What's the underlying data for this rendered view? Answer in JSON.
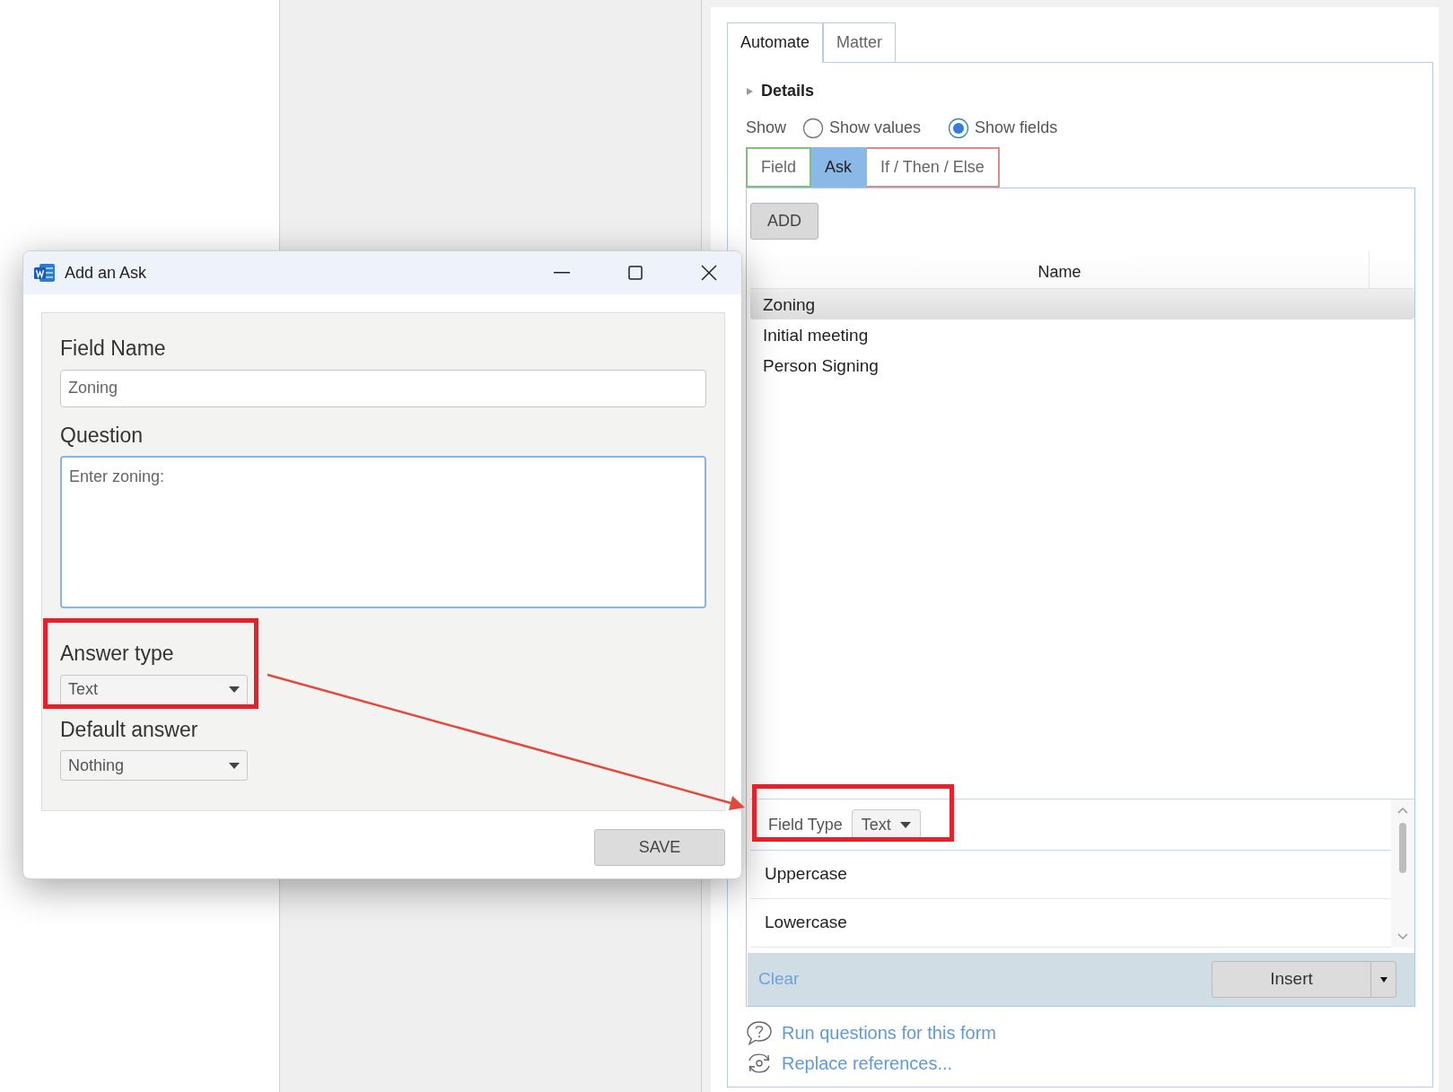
{
  "dialog": {
    "title": "Add an Ask",
    "field_name": {
      "label": "Field Name",
      "value": "Zoning"
    },
    "question": {
      "label": "Question",
      "value": "Enter zoning:"
    },
    "answer_type": {
      "label": "Answer type",
      "value": "Text"
    },
    "default_answer": {
      "label": "Default answer",
      "value": "Nothing"
    },
    "save_button": "SAVE"
  },
  "panel": {
    "tabs": [
      {
        "label": "Automate",
        "selected": true
      },
      {
        "label": "Matter",
        "selected": false
      }
    ],
    "details": {
      "label": "Details",
      "expanded": false
    },
    "show": {
      "label": "Show",
      "options": [
        {
          "label": "Show values",
          "selected": false
        },
        {
          "label": "Show fields",
          "selected": true
        }
      ]
    },
    "subtabs": [
      {
        "label": "Field",
        "selected": false,
        "color": "#7cc576"
      },
      {
        "label": "Ask",
        "selected": true,
        "color": "#8ab9e8"
      },
      {
        "label": "If / Then / Else",
        "selected": false,
        "color": "#e08a8a"
      }
    ],
    "add_button": "ADD",
    "table": {
      "columns": [
        "Name"
      ],
      "rows": [
        {
          "name": "Zoning",
          "selected": true
        },
        {
          "name": "Initial meeting",
          "selected": false
        },
        {
          "name": "Person Signing",
          "selected": false
        }
      ]
    },
    "field_type": {
      "label": "Field Type",
      "value": "Text"
    },
    "options": [
      "Uppercase",
      "Lowercase"
    ],
    "clear": "Clear",
    "insert": "Insert",
    "links": [
      {
        "kind": "question",
        "text": "Run questions for this form"
      },
      {
        "kind": "replace",
        "text": "Replace references..."
      }
    ]
  }
}
